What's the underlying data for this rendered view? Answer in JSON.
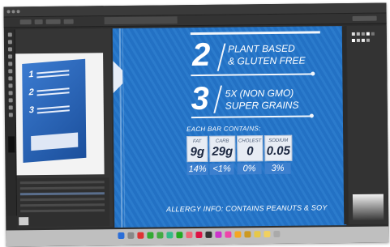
{
  "panel": {
    "feature_1_number": "2",
    "feature_1_text_line1": "PLANT BASED",
    "feature_1_text_line2": "& GLUTEN FREE",
    "feature_2_number": "3",
    "feature_2_text_line1": "5X (NON GMO)",
    "feature_2_text_line2": "SUPER GRAINS",
    "each_bar_label": "EACH BAR CONTAINS:",
    "nutrition": [
      {
        "label": "FAT",
        "value": "9g"
      },
      {
        "label": "CARB",
        "value": "29g"
      },
      {
        "label": "CHOLEST",
        "value": "0"
      },
      {
        "label": "SODIUM",
        "value": "0.05"
      }
    ],
    "percents": [
      "14%",
      "<1%",
      "0%",
      "3%"
    ],
    "allergy": "ALLERGY INFO: CONTAINS PEANUTS & SOY"
  },
  "thumbnail": {
    "numbers": [
      "1",
      "2",
      "3"
    ]
  },
  "colors": {
    "package_blue": "#2371c4",
    "ui_dark": "#2d2d2d",
    "panel_light": "#e7ecf4"
  }
}
